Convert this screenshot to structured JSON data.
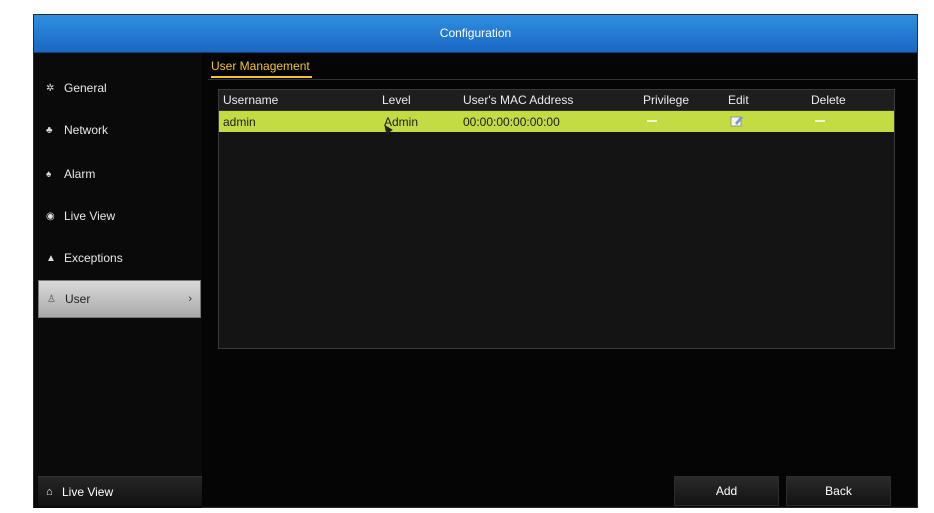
{
  "window": {
    "title": "Configuration"
  },
  "sidebar": {
    "items": [
      {
        "label": "General",
        "icon": "gear-icon"
      },
      {
        "label": "Network",
        "icon": "network-icon"
      },
      {
        "label": "Alarm",
        "icon": "alarm-icon"
      },
      {
        "label": "Live View",
        "icon": "eye-icon"
      },
      {
        "label": "Exceptions",
        "icon": "warning-icon"
      },
      {
        "label": "User",
        "icon": "user-icon",
        "active": true
      }
    ],
    "bottom": {
      "label": "Live View",
      "icon": "home-icon"
    }
  },
  "main": {
    "tab": "User Management",
    "table": {
      "columns": [
        "Username",
        "Level",
        "User's MAC Address",
        "Privilege",
        "Edit",
        "Delete"
      ],
      "rows": [
        {
          "username": "admin",
          "level": "Admin",
          "mac": "00:00:00:00:00:00",
          "privilege": "disabled",
          "edit": "edit-icon",
          "delete": "disabled"
        }
      ]
    },
    "buttons": {
      "add": "Add",
      "back": "Back"
    }
  },
  "colors": {
    "titlebar": "#1a67c2",
    "selected_row": "#c4dc43",
    "tab_accent": "#f2c230"
  }
}
